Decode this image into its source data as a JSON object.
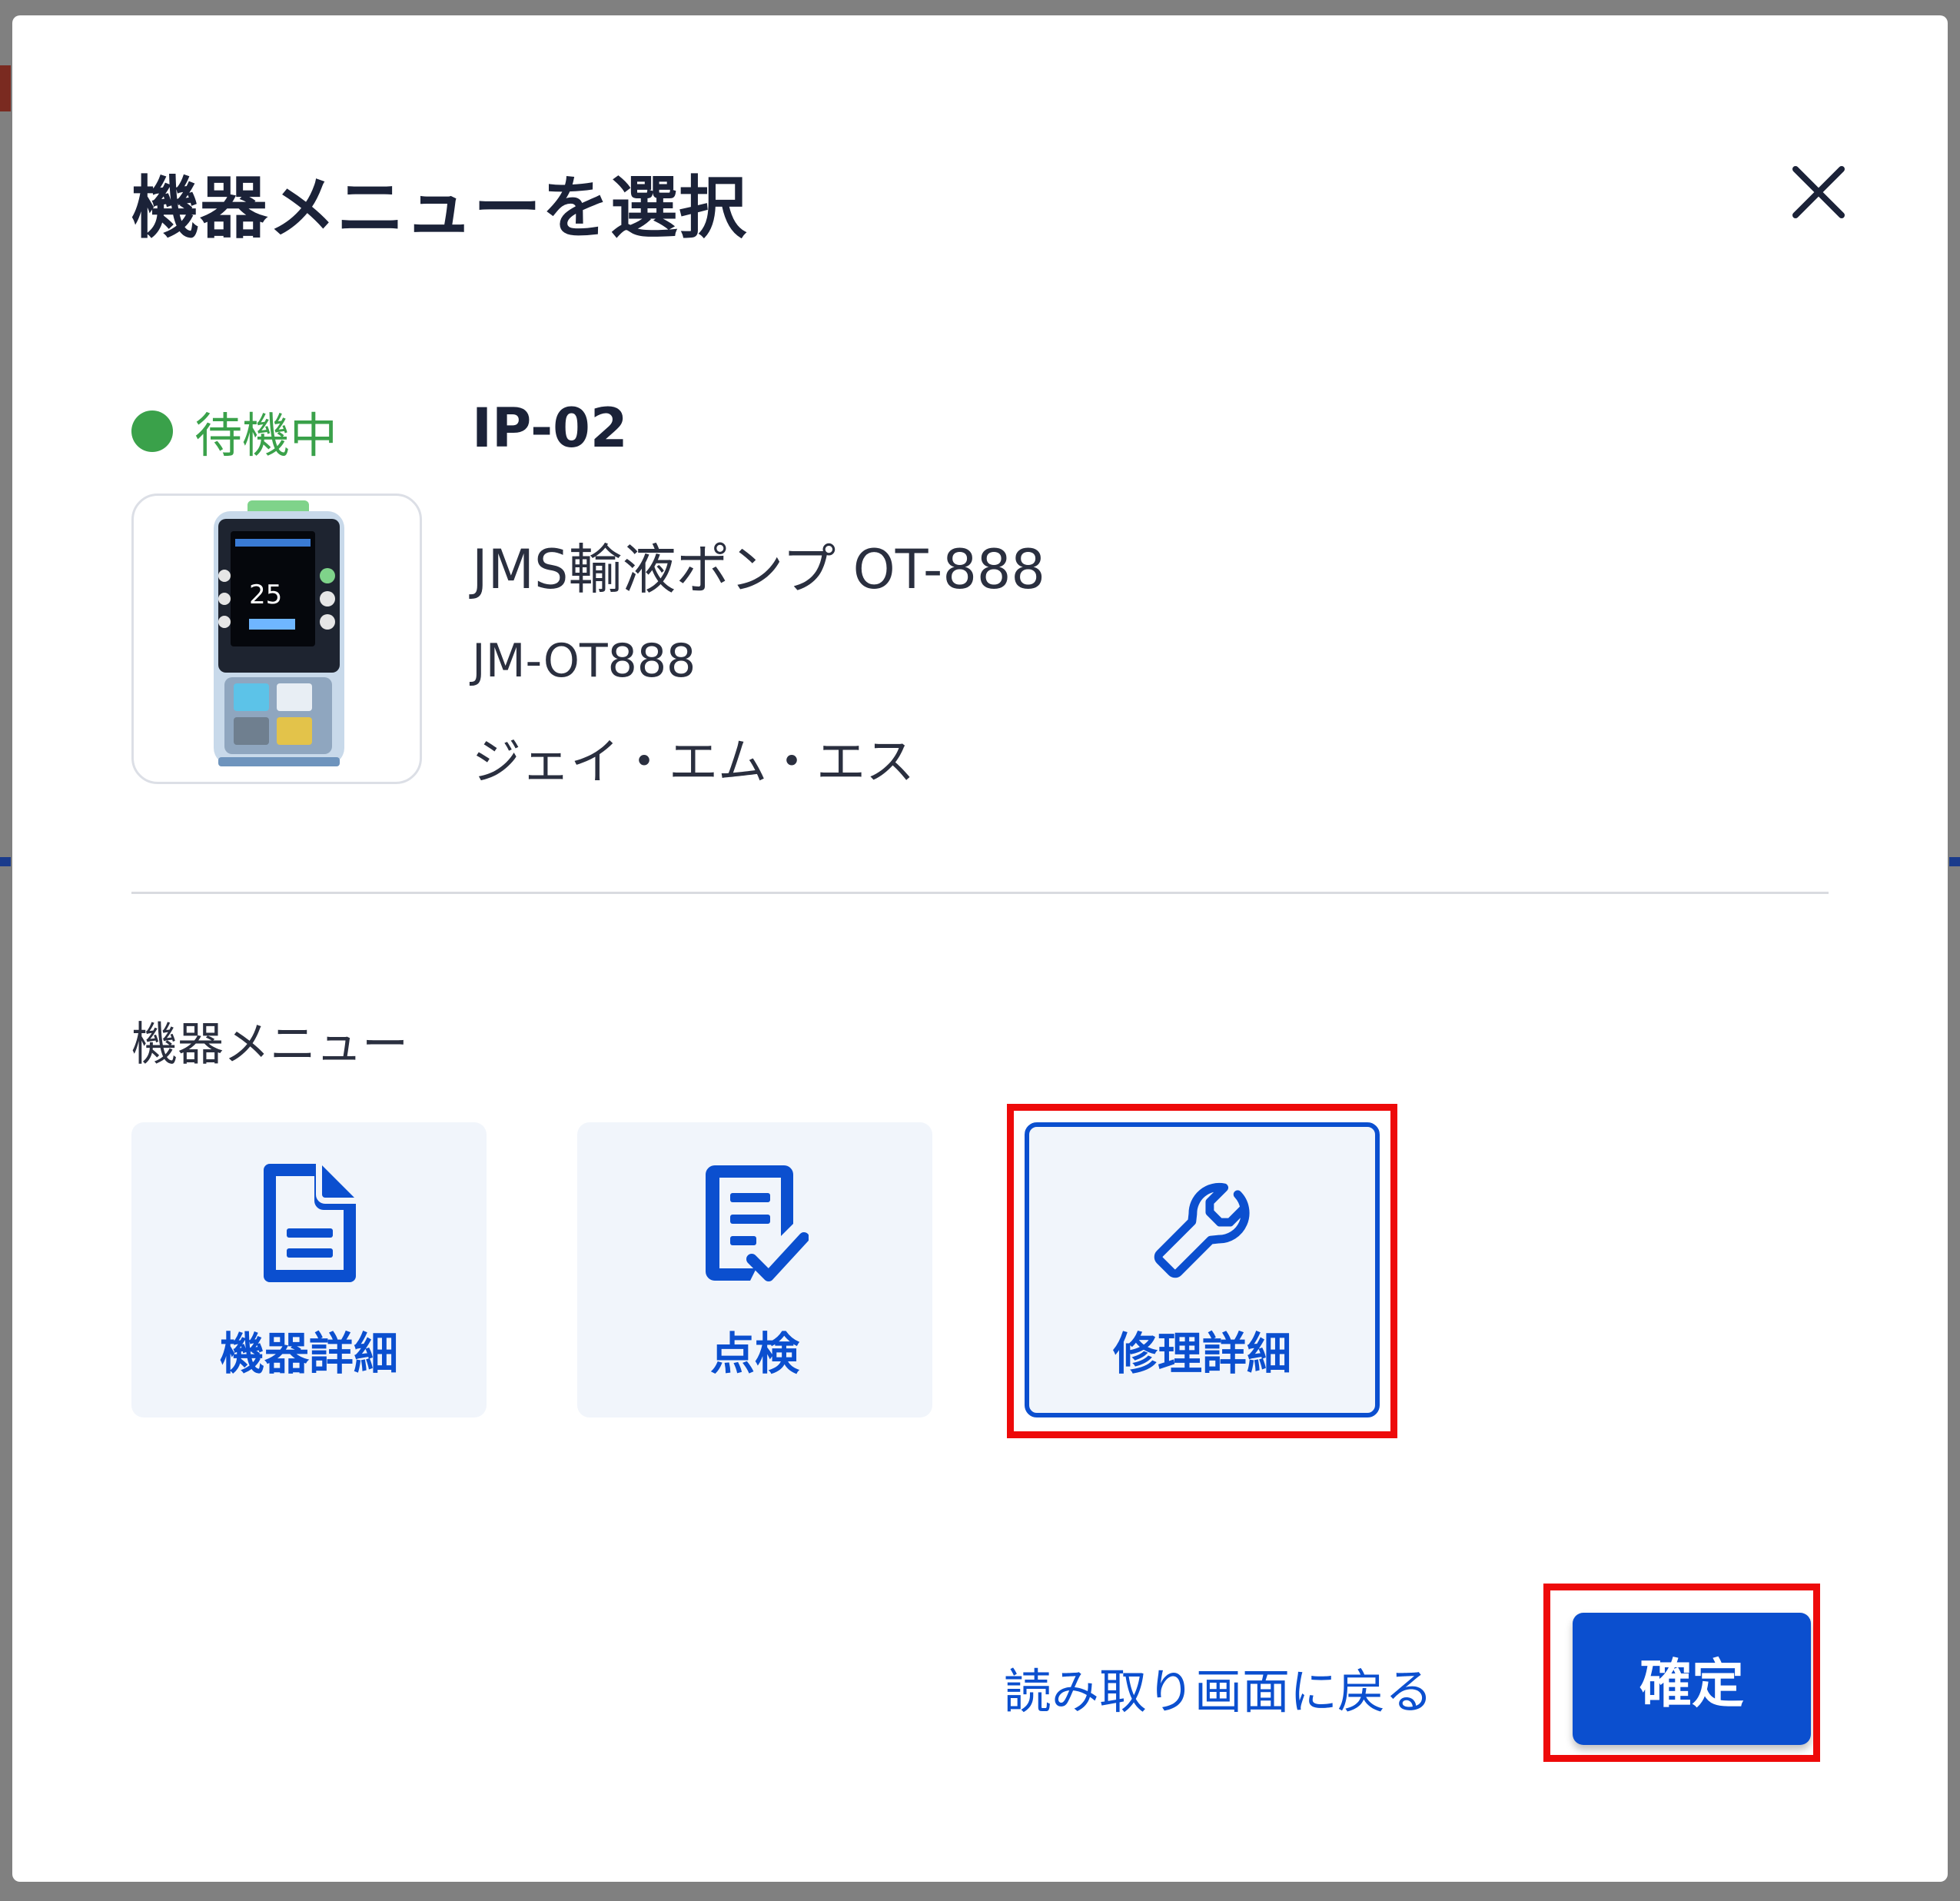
{
  "dialog": {
    "title": "機器メニューを選択",
    "close_icon": "close-icon"
  },
  "device": {
    "status": "待機中",
    "status_color": "#3aa14a",
    "id": "IP-02",
    "name": "JMS輸液ポンプ OT-888",
    "model": "JM-OT888",
    "manufacturer": "ジェイ・エム・エス",
    "image": "infusion-pump-image"
  },
  "menu": {
    "section_label": "機器メニュー",
    "items": [
      {
        "label": "機器詳細",
        "icon": "document-icon",
        "selected": false
      },
      {
        "label": "点検",
        "icon": "checklist-icon",
        "selected": false
      },
      {
        "label": "修理詳細",
        "icon": "wrench-icon",
        "selected": true
      }
    ]
  },
  "footer": {
    "back_label": "読み取り画面に戻る",
    "confirm_label": "確定"
  },
  "colors": {
    "accent": "#0b4fcf",
    "title_text": "#1b2238",
    "card_background": "#f1f5fb",
    "highlight": "#ee0a0a"
  }
}
